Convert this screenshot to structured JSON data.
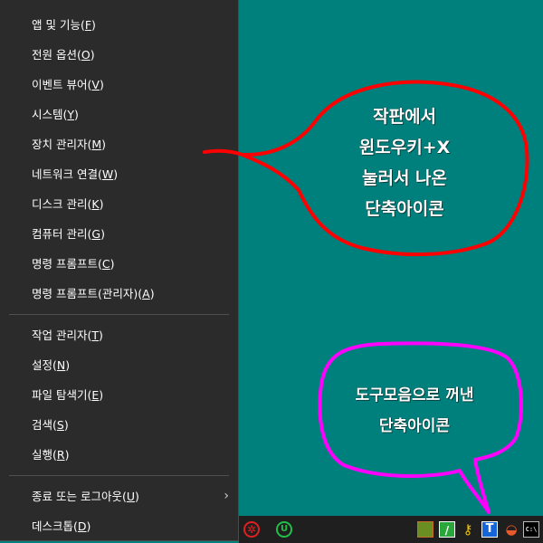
{
  "menu": {
    "group1": [
      {
        "label": "앱 및 기능",
        "key": "F"
      },
      {
        "label": "전원 옵션",
        "key": "O"
      },
      {
        "label": "이벤트 뷰어",
        "key": "V"
      },
      {
        "label": "시스템",
        "key": "Y"
      },
      {
        "label": "장치 관리자",
        "key": "M"
      },
      {
        "label": "네트워크 연결",
        "key": "W"
      },
      {
        "label": "디스크 관리",
        "key": "K"
      },
      {
        "label": "컴퓨터 관리",
        "key": "G"
      },
      {
        "label": "명령 프롬프트",
        "key": "C"
      },
      {
        "label": "명령 프롬프트(관리자)",
        "key": "A"
      }
    ],
    "group2": [
      {
        "label": "작업 관리자",
        "key": "T"
      },
      {
        "label": "설정",
        "key": "N"
      },
      {
        "label": "파일 탐색기",
        "key": "E"
      },
      {
        "label": "검색",
        "key": "S"
      },
      {
        "label": "실행",
        "key": "R"
      }
    ],
    "group3": [
      {
        "label": "종료 또는 로그아웃",
        "key": "U",
        "arrow": "›"
      },
      {
        "label": "데스크톱",
        "key": "D"
      }
    ]
  },
  "annotations": {
    "red_bubble": {
      "line1": "작판에서",
      "line2": "윈도우키+X",
      "line3": "눌러서 나온",
      "line4": "단축아이콘",
      "color": "#ff0000"
    },
    "magenta_bubble": {
      "line1": "도구모음으로 꺼낸",
      "line2": "단축아이콘",
      "color": "#ff00ff"
    }
  },
  "taskbar": {
    "icons": [
      "settings-gear-icon",
      "green-u-icon",
      "image-app-icon",
      "notepad-icon",
      "key-icon",
      "t-text-icon",
      "paint-icon",
      "cmd-icon"
    ],
    "t_label": "T",
    "u_label": "U",
    "cmd_label": "C:\\",
    "colors": {
      "desktop": "#00807d",
      "menu_bg": "#2b2b2b",
      "taskbar_bg": "#1f1f1f"
    }
  }
}
